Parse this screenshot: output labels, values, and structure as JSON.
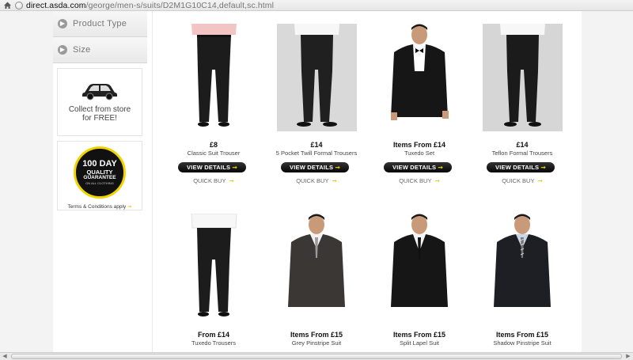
{
  "browser": {
    "url_host": "direct.asda.com",
    "url_path": "/george/men-s/suits/D2M1G10C14,default,sc.html"
  },
  "sidebar": {
    "filters": [
      {
        "label": "Product Type"
      },
      {
        "label": "Size"
      }
    ],
    "collect_line1": "Collect from store",
    "collect_line2": "for FREE!",
    "guarantee": {
      "line1": "100 DAY",
      "line2": "QUALITY",
      "line3": "GUARANTEE",
      "line4": "ON ALL CLOTHING",
      "terms": "Terms & Conditions apply"
    }
  },
  "products": [
    {
      "price": "£8",
      "name": "Classic Suit Trouser",
      "image": "trouser-pink-shirt"
    },
    {
      "price": "£14",
      "name": "5 Pocket Twill Formal Trousers",
      "image": "trouser-grey-bg"
    },
    {
      "price": "Items From £14",
      "name": "Tuxedo Set",
      "image": "tuxedo-model"
    },
    {
      "price": "£14",
      "name": "Teflon Formal Trousers",
      "image": "trouser-grey-bg"
    },
    {
      "price": "From £14",
      "name": "Tuxedo Trousers",
      "image": "trouser-white"
    },
    {
      "price": "Items From £15",
      "name": "Grey Pinstripe Suit",
      "image": "grey-suit-model"
    },
    {
      "price": "Items From £15",
      "name": "Split Lapel Suit",
      "image": "black-suit-model"
    },
    {
      "price": "Items From £15",
      "name": "Shadow Pinstripe Suit",
      "image": "striped-tie-model"
    }
  ],
  "buttons": {
    "view_details": "VIEW DETAILS",
    "quick_buy": "QUICK BUY"
  },
  "colors": {
    "accent_yellow": "#f2d000",
    "button_black": "#111111"
  }
}
